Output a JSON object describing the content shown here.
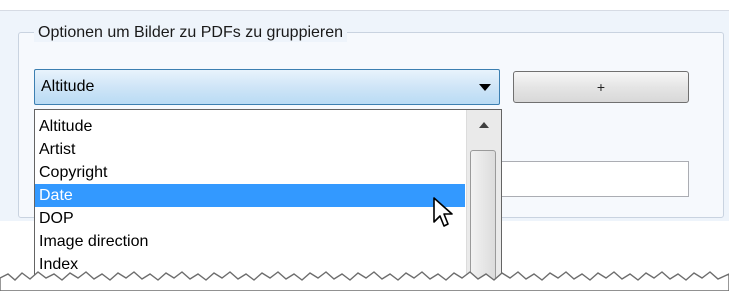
{
  "group": {
    "title": "Optionen um Bilder zu PDFs zu gruppieren"
  },
  "combo": {
    "selected": "Altitude"
  },
  "add_button": {
    "label": "+"
  },
  "dropdown": {
    "items": [
      "Altitude",
      "Artist",
      "Copyright",
      "Date",
      "DOP",
      "Image direction",
      "Index"
    ],
    "selected_index": 3
  },
  "icons": [
    "chevron-down-icon",
    "scroll-up-arrow-icon",
    "mouse-pointer-icon"
  ],
  "colors": {
    "selection": "#3399ff",
    "combo_border": "#3c7fb1"
  }
}
